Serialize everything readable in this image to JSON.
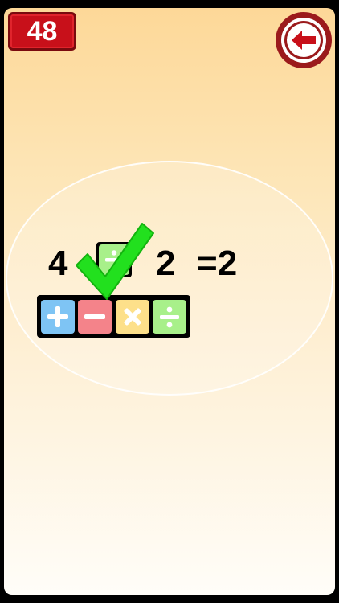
{
  "score": {
    "value": "48"
  },
  "back_button": {
    "icon": "arrow-left-icon",
    "color": "#9b1a1c"
  },
  "equation": {
    "left_operand": "4",
    "selected_operator": "divide",
    "right_operand": "2",
    "result": "=2"
  },
  "feedback": {
    "icon": "checkmark-icon",
    "color": "#22e01e"
  },
  "operators": [
    {
      "name": "plus",
      "icon": "plus-icon",
      "color": "#7ec4f4"
    },
    {
      "name": "minus",
      "icon": "minus-icon",
      "color": "#f4838a"
    },
    {
      "name": "multiply",
      "icon": "multiply-icon",
      "color": "#fde08a"
    },
    {
      "name": "divide",
      "icon": "divide-icon",
      "color": "#a8f08a"
    }
  ]
}
